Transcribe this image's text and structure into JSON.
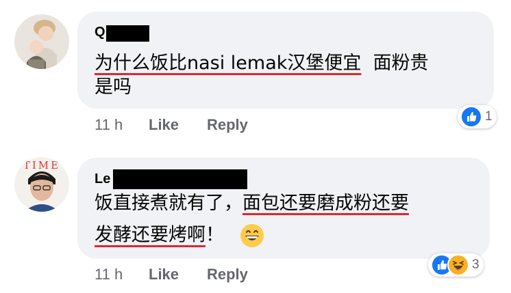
{
  "comments": [
    {
      "author_visible": "Q",
      "lines": [
        {
          "ul": "为什么饭比nasi lemak汉堡便宜",
          "rest": "  面粉贵"
        },
        {
          "ul": "",
          "rest": "是吗"
        }
      ],
      "time": "11 h",
      "like_label": "Like",
      "reply_label": "Reply",
      "reaction_count": "1"
    },
    {
      "author_visible": "Le",
      "lines": [
        {
          "pre": "饭直接煮就有了，",
          "ul": "面包还要磨成粉还要"
        },
        {
          "pre": "",
          "ul": "发酵还要烤啊",
          "rest": "！"
        }
      ],
      "emoji": "😄",
      "time": "11 h",
      "like_label": "Like",
      "reply_label": "Reply",
      "reaction_count": "3"
    }
  ],
  "reaction_icons": [
    "like-icon",
    "haha-icon"
  ],
  "colors": {
    "bubble": "#f0f2f5",
    "underline": "#e5242c",
    "like_blue": "#1877f2",
    "meta": "#65676b"
  }
}
